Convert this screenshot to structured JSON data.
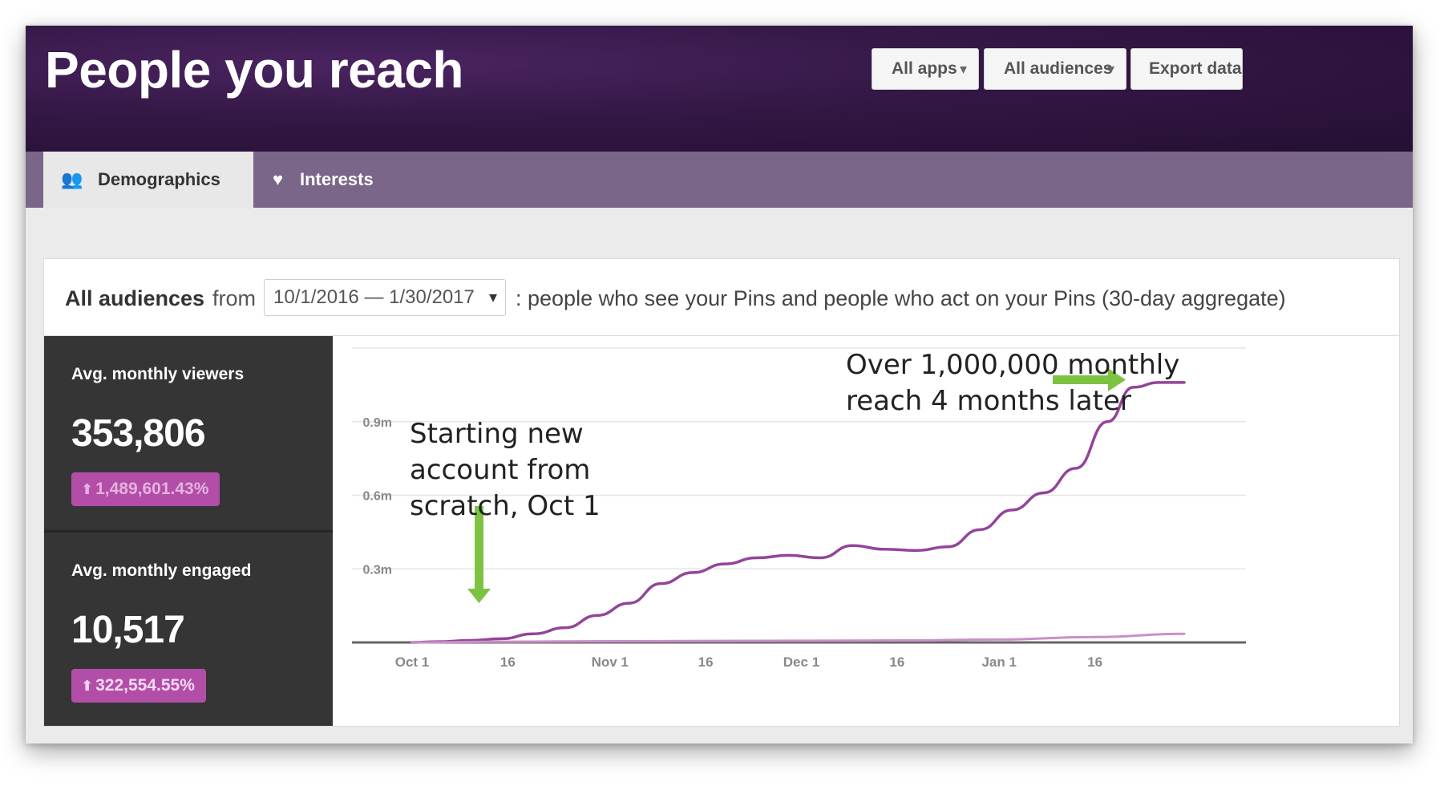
{
  "header": {
    "title": "People you reach",
    "buttons": [
      {
        "label": "All apps",
        "has_caret": true
      },
      {
        "label": "All audiences",
        "has_caret": true
      },
      {
        "label": "Export data",
        "has_caret": false
      }
    ],
    "caret_glyph": "▾"
  },
  "tabs": [
    {
      "label": "Demographics",
      "icon": "people-icon",
      "glyph": "👥",
      "active": true
    },
    {
      "label": "Interests",
      "icon": "heart-icon",
      "glyph": "♥",
      "active": false
    }
  ],
  "filter": {
    "audience": "All audiences",
    "from_word": "from",
    "date_range": "10/1/2016 — 1/30/2017",
    "description": ": people who see your Pins and people who act on your Pins (30-day aggregate)"
  },
  "stats": [
    {
      "label": "Avg. monthly viewers",
      "value": "353,806",
      "change": "1,489,601.43%",
      "arrow": "⬆"
    },
    {
      "label": "Avg. monthly engaged",
      "value": "10,517",
      "change": "322,554.55%",
      "arrow": "⬆"
    }
  ],
  "annotations": {
    "start": [
      "Starting new",
      "account from",
      "scratch, Oct 1"
    ],
    "growth": [
      "Over 1,000,000 monthly",
      "reach 4 months later"
    ]
  },
  "colors": {
    "header_bg": "#331744",
    "tabbar_bg": "#7a6688",
    "series_viewers": "#93449a",
    "series_engaged": "#c890c7",
    "badge": "#b24ea8",
    "annotation_arrow": "#7ec242"
  },
  "chart_data": {
    "type": "line",
    "x_tick_labels": [
      "Oct 1",
      "16",
      "Nov 1",
      "16",
      "Dec 1",
      "16",
      "Jan 1",
      "16"
    ],
    "x_tick_dates": [
      "2016-10-01",
      "2016-10-16",
      "2016-11-01",
      "2016-11-16",
      "2016-12-01",
      "2016-12-16",
      "2017-01-01",
      "2017-01-16"
    ],
    "y_tick_labels": [
      "0.3m",
      "0.6m",
      "0.9m"
    ],
    "y_ticks": [
      300000,
      600000,
      900000
    ],
    "ylim": [
      0,
      1200000
    ],
    "xlim": [
      "2016-10-01",
      "2017-01-30"
    ],
    "grid": true,
    "series": [
      {
        "key": "viewers",
        "x": [
          "2016-10-01",
          "2016-10-05",
          "2016-10-10",
          "2016-10-15",
          "2016-10-20",
          "2016-10-25",
          "2016-10-30",
          "2016-11-04",
          "2016-11-09",
          "2016-11-14",
          "2016-11-19",
          "2016-11-24",
          "2016-11-29",
          "2016-12-04",
          "2016-12-09",
          "2016-12-14",
          "2016-12-19",
          "2016-12-24",
          "2016-12-29",
          "2017-01-03",
          "2017-01-08",
          "2017-01-13",
          "2017-01-18",
          "2017-01-22",
          "2017-01-26",
          "2017-01-30"
        ],
        "y": [
          0,
          3000,
          8000,
          15000,
          35000,
          60000,
          110000,
          160000,
          240000,
          285000,
          320000,
          345000,
          355000,
          345000,
          395000,
          380000,
          375000,
          390000,
          460000,
          540000,
          610000,
          710000,
          900000,
          1040000,
          1060000,
          1060000
        ]
      },
      {
        "key": "engaged",
        "x": [
          "2016-10-01",
          "2016-10-16",
          "2016-11-01",
          "2016-11-16",
          "2016-12-01",
          "2016-12-16",
          "2017-01-01",
          "2017-01-16",
          "2017-01-30"
        ],
        "y": [
          0,
          3000,
          5000,
          6000,
          7000,
          8000,
          12000,
          22000,
          35000
        ]
      }
    ]
  }
}
